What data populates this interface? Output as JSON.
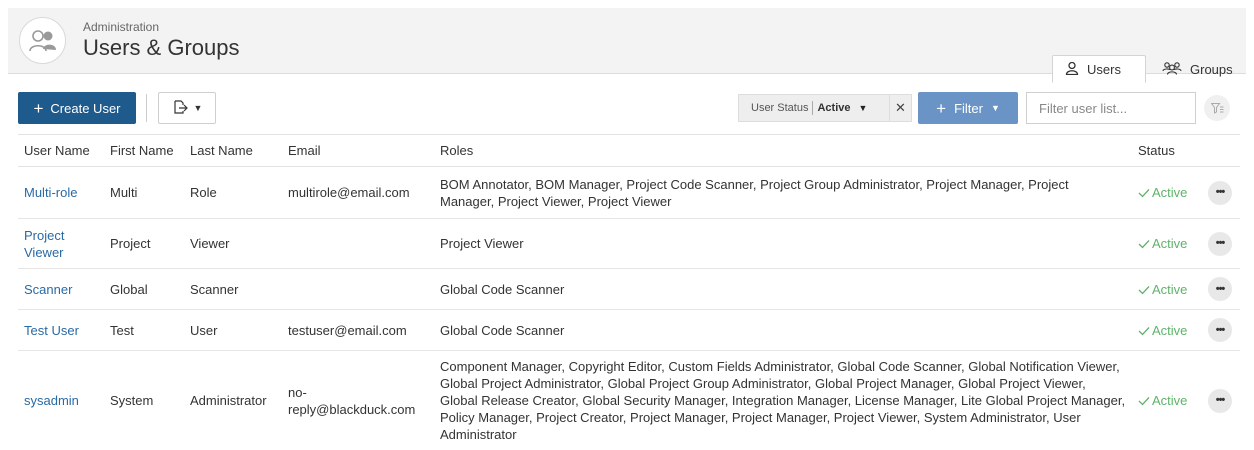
{
  "header": {
    "breadcrumb": "Administration",
    "title": "Users & Groups"
  },
  "tabs": [
    {
      "label": "Users",
      "icon": "user-icon",
      "active": true
    },
    {
      "label": "Groups",
      "icon": "groups-icon",
      "active": false
    }
  ],
  "toolbar": {
    "create_label": "Create User",
    "filter_chip": {
      "label": "User Status",
      "value": "Active"
    },
    "filter_label": "Filter",
    "search_placeholder": "Filter user list..."
  },
  "table": {
    "columns": [
      "User Name",
      "First Name",
      "Last Name",
      "Email",
      "Roles",
      "Status"
    ],
    "rows": [
      {
        "username": "Multi-role",
        "first": "Multi",
        "last": "Role",
        "email": "multirole@email.com",
        "roles": "BOM Annotator, BOM Manager, Project Code Scanner, Project Group Administrator, Project Manager, Project Manager, Project Viewer, Project Viewer",
        "status": "Active"
      },
      {
        "username": "Project Viewer",
        "first": "Project",
        "last": "Viewer",
        "email": "",
        "roles": "Project Viewer",
        "status": "Active"
      },
      {
        "username": "Scanner",
        "first": "Global",
        "last": "Scanner",
        "email": "",
        "roles": "Global Code Scanner",
        "status": "Active"
      },
      {
        "username": "Test User",
        "first": "Test",
        "last": "User",
        "email": "testuser@email.com",
        "roles": "Global Code Scanner",
        "status": "Active"
      },
      {
        "username": "sysadmin",
        "first": "System",
        "last": "Administrator",
        "email": "no-reply@blackduck.com",
        "roles": "Component Manager, Copyright Editor, Custom Fields Administrator, Global Code Scanner, Global Notification Viewer, Global Project Administrator, Global Project Group Administrator, Global Project Manager, Global Project Viewer, Global Release Creator, Global Security Manager, Integration Manager, License Manager, Lite Global Project Manager, Policy Manager, Project Creator, Project Manager, Project Manager, Project Viewer, System Administrator, User Administrator",
        "status": "Active"
      }
    ]
  },
  "colors": {
    "primary": "#1f5a8c",
    "filter_button": "#6b94c6",
    "link": "#2a6aa4",
    "active_status": "#5fb36a"
  }
}
